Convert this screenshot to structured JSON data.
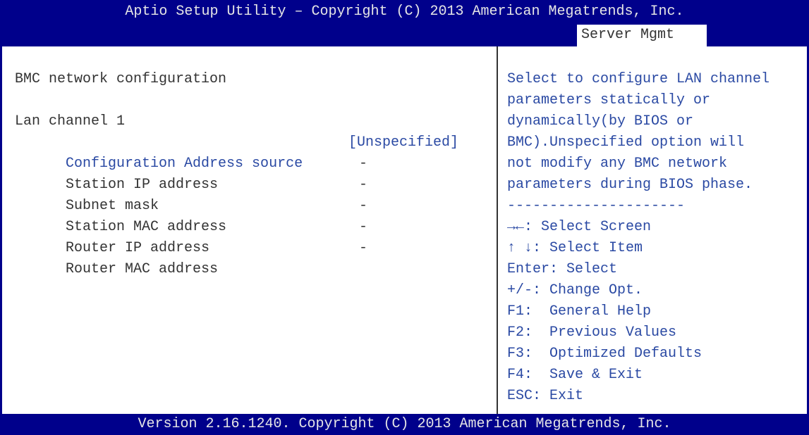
{
  "header": {
    "title": "Aptio Setup Utility – Copyright (C) 2013 American Megatrends, Inc.",
    "active_tab": "Server Mgmt"
  },
  "menu": {
    "section_title": "BMC network configuration",
    "group_label": "Lan channel 1",
    "items": [
      {
        "label": "Configuration Address source",
        "value": "[Unspecified]"
      },
      {
        "label": "Station IP address",
        "value": "-"
      },
      {
        "label": "Subnet mask",
        "value": "-"
      },
      {
        "label": "Station MAC address",
        "value": "-"
      },
      {
        "label": "Router IP address",
        "value": "-"
      },
      {
        "label": "Router MAC address",
        "value": "-"
      }
    ]
  },
  "help": {
    "description": [
      "Select to configure LAN channel",
      "parameters statically or",
      "dynamically(by BIOS or",
      "BMC).Unspecified option will",
      "not modify any BMC network",
      "parameters during BIOS phase."
    ],
    "separator": "---------------------",
    "keys": [
      "→←: Select Screen",
      "↑ ↓: Select Item",
      "Enter: Select",
      "+/-: Change Opt.",
      "F1:  General Help",
      "F2:  Previous Values",
      "F3:  Optimized Defaults",
      "F4:  Save & Exit",
      "ESC: Exit"
    ]
  },
  "footer": {
    "version": "Version 2.16.1240. Copyright (C) 2013 American Megatrends, Inc."
  },
  "colors": {
    "bar": "#00008b",
    "bar_text": "#e6e6e6",
    "text": "#333333",
    "highlight": "#2a49a3"
  }
}
